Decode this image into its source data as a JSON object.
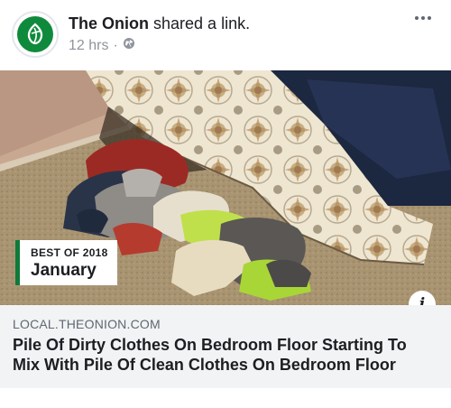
{
  "post": {
    "author": "The Onion",
    "action": "shared a link.",
    "time": "12 hrs",
    "separator": "·",
    "privacy_icon": "globe-icon",
    "more_icon": "ellipsis-icon"
  },
  "link": {
    "badge_top": "BEST OF 2018",
    "badge_main": "January",
    "info_label": "i",
    "domain": "LOCAL.THEONION.COM",
    "title": "Pile Of Dirty Clothes On Bedroom Floor Starting To Mix With Pile Of Clean Clothes On Bedroom Floor"
  },
  "colors": {
    "brand_green": "#0f8a3c",
    "caption_bg": "#f2f3f5",
    "meta_gray": "#90949c"
  }
}
